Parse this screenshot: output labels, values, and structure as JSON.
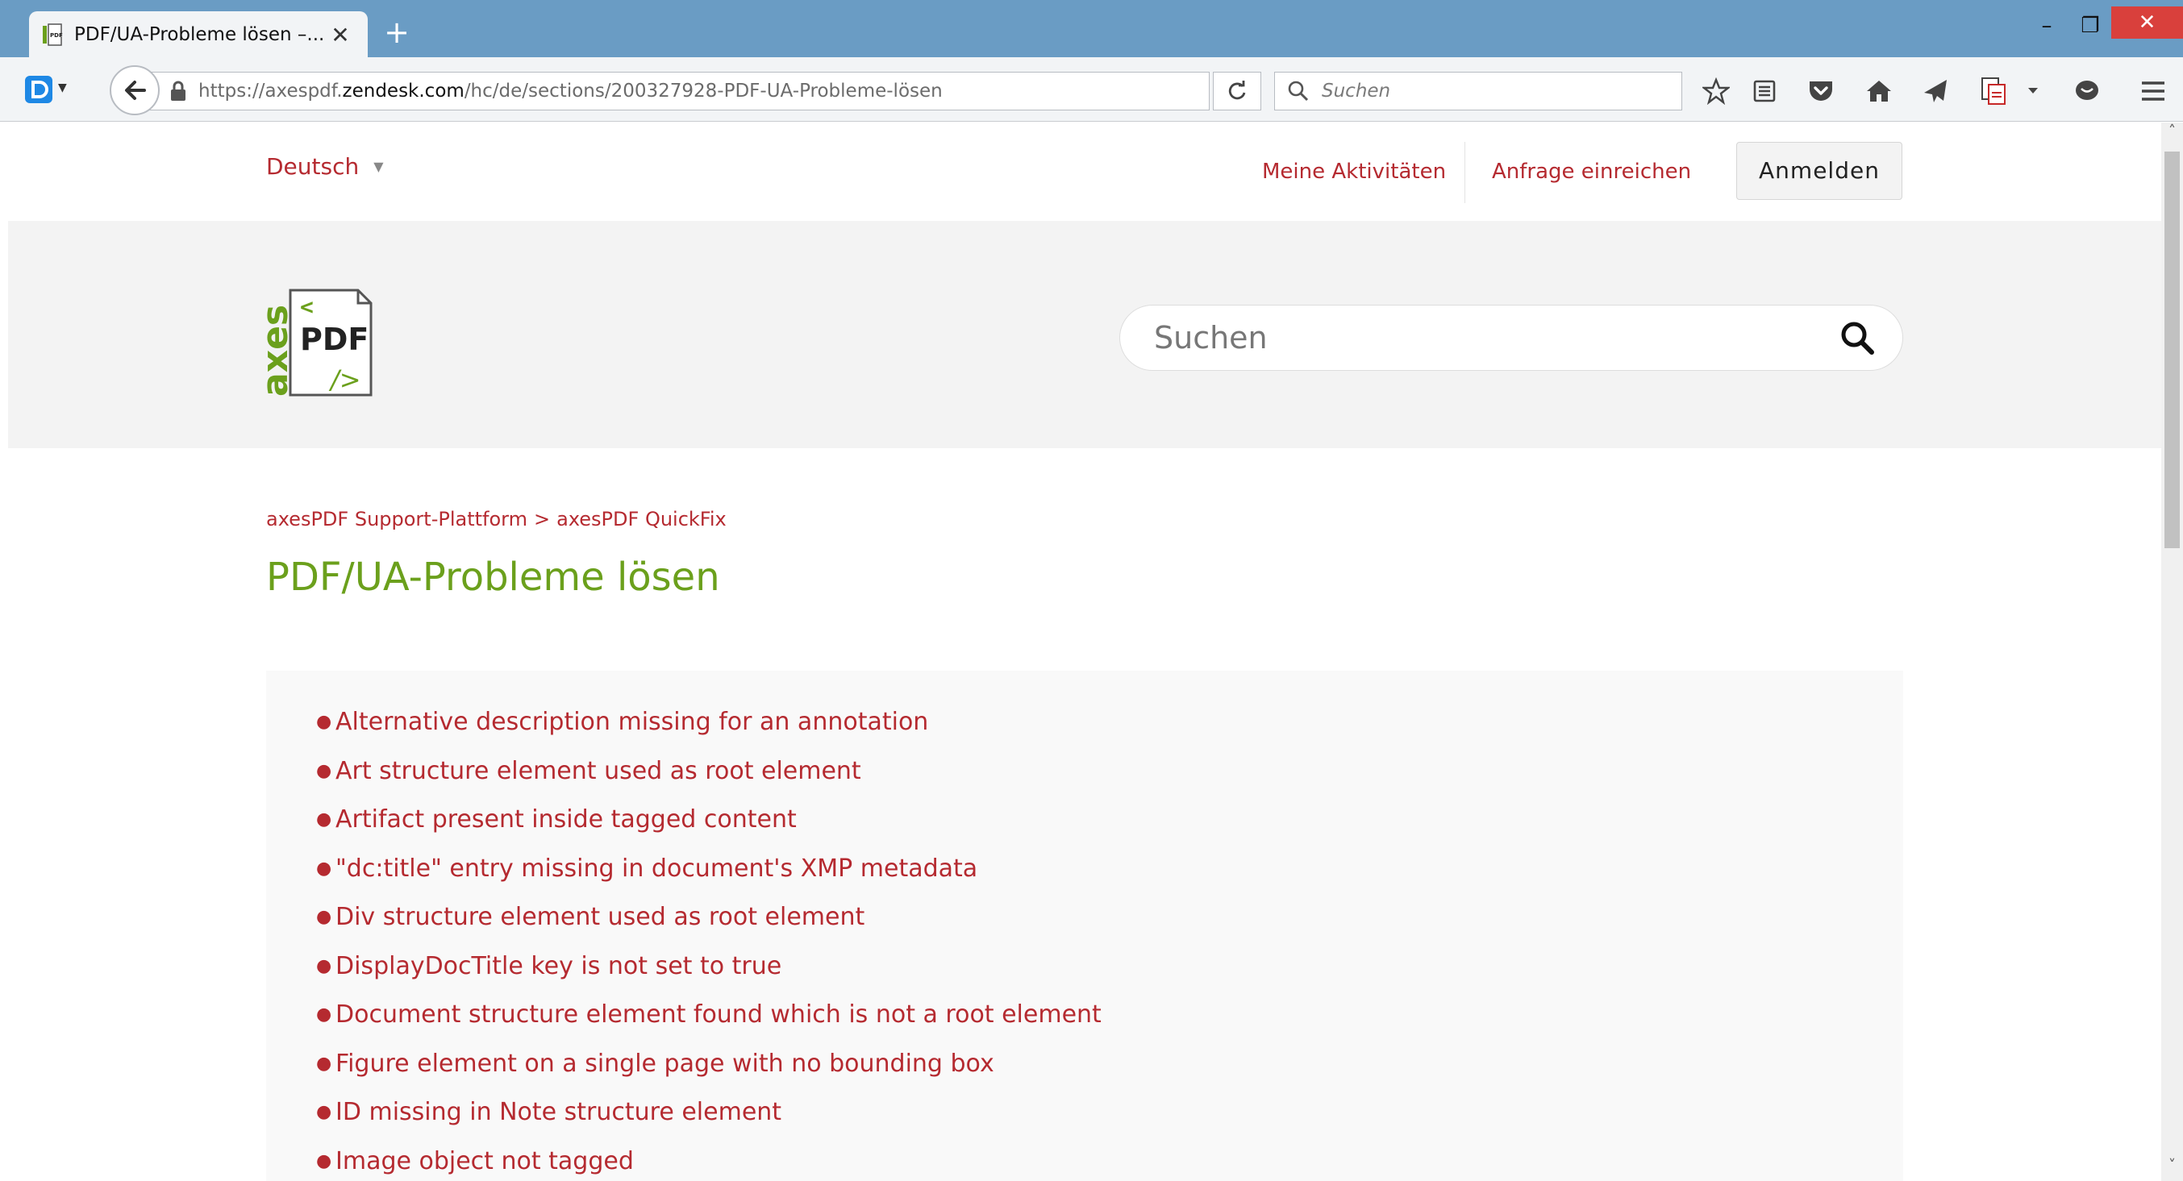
{
  "browser": {
    "tab_title": "PDF/UA-Probleme lösen –...",
    "tab_close": "✕",
    "new_tab": "+",
    "url_prefix": "https://axespdf.",
    "url_domain": "zendesk.com",
    "url_path": "/hc/de/sections/200327928-PDF-UA-Probleme-lösen",
    "search_placeholder": "Suchen",
    "window_min": "–",
    "window_max": "❐",
    "window_close": "✕"
  },
  "header": {
    "language": "Deutsch",
    "links": {
      "activities": "Meine Aktivitäten",
      "request": "Anfrage einreichen"
    },
    "login_label": "Anmelden"
  },
  "hero": {
    "logo_text_side": "axes",
    "logo_text_doc": "PDF",
    "search_placeholder": "Suchen"
  },
  "breadcrumb": {
    "items": [
      "axesPDF Support-Plattform",
      "axesPDF QuickFix"
    ],
    "separator": ">"
  },
  "page_title": "PDF/UA-Probleme lösen",
  "articles": [
    "Alternative description missing for an annotation",
    "Art structure element used as root element",
    "Artifact present inside tagged content",
    "\"dc:title\" entry missing in document's XMP metadata",
    "Div structure element used as root element",
    "DisplayDocTitle key is not set to true",
    "Document structure element found which is not a root element",
    "Figure element on a single page with no bounding box",
    "ID missing in Note structure element",
    "Image object not tagged"
  ],
  "colors": {
    "link": "#b52a30",
    "title_green": "#6ba01c",
    "titlebar": "#6a9cc4"
  }
}
